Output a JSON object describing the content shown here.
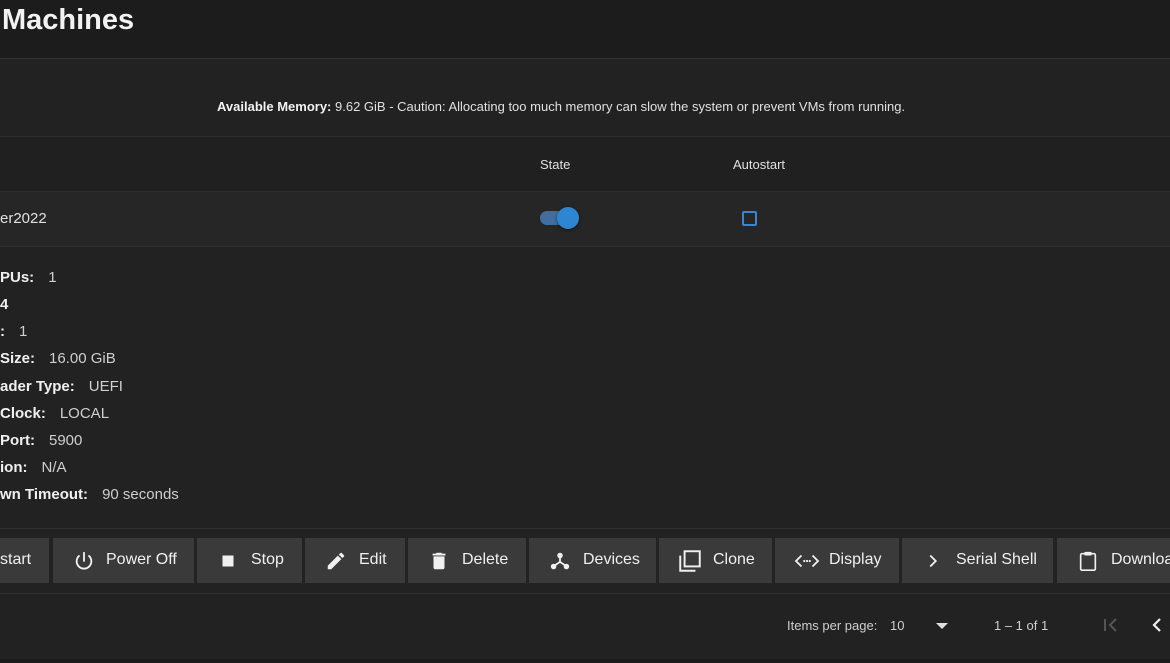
{
  "header": {
    "title": "Machines"
  },
  "memory": {
    "label": "Available Memory:",
    "text": " 9.62 GiB - Caution: Allocating too much memory can slow the system or prevent VMs from running."
  },
  "table": {
    "columns": {
      "state": "State",
      "autostart": "Autostart"
    },
    "row": {
      "name": "er2022",
      "state_running": true,
      "autostart": false
    }
  },
  "details": [
    {
      "label": "PUs:",
      "value": "1"
    },
    {
      "label": "4",
      "value": ""
    },
    {
      "label": ":",
      "value": "1"
    },
    {
      "label": "Size:",
      "value": "16.00 GiB"
    },
    {
      "label": "ader Type:",
      "value": "UEFI"
    },
    {
      "label": "Clock:",
      "value": "LOCAL"
    },
    {
      "label": "Port:",
      "value": "5900"
    },
    {
      "label": "ion:",
      "value": "N/A"
    },
    {
      "label": "wn Timeout:",
      "value": "90 seconds"
    }
  ],
  "actions": {
    "restart": "start",
    "power_off": "Power Off",
    "stop": "Stop",
    "edit": "Edit",
    "delete": "Delete",
    "devices": "Devices",
    "clone": "Clone",
    "display": "Display",
    "serial_shell": "Serial Shell",
    "download": "Downloa"
  },
  "paginator": {
    "items_per_page_label": "Items per page:",
    "items_per_page_value": "10",
    "range": "1 – 1 of 1"
  },
  "colors": {
    "accent": "#2e86d3",
    "button_bg": "#3a3a3a"
  }
}
